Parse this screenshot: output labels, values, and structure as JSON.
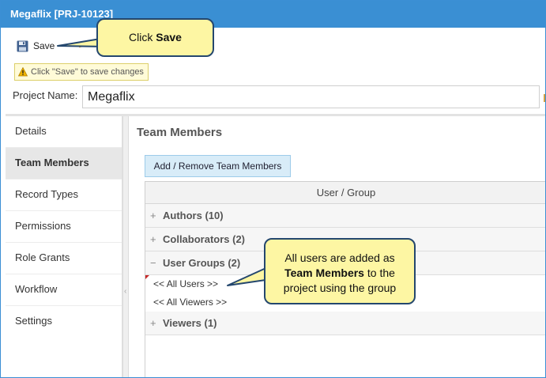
{
  "window": {
    "title": "Megaflix [PRJ-10123]"
  },
  "toolbar": {
    "save_label": "Save"
  },
  "warning": {
    "text": "Click \"Save\" to save changes"
  },
  "project": {
    "name_label": "Project Name:",
    "name_value": "Megaflix"
  },
  "sidebar": {
    "items": [
      {
        "label": "Details"
      },
      {
        "label": "Team Members"
      },
      {
        "label": "Record Types"
      },
      {
        "label": "Permissions"
      },
      {
        "label": "Role Grants"
      },
      {
        "label": "Workflow"
      },
      {
        "label": "Settings"
      }
    ]
  },
  "main": {
    "title": "Team Members",
    "add_button": "Add / Remove Team Members",
    "column_header": "User / Group",
    "groups": [
      {
        "label": "Authors (10)",
        "toggle": "+"
      },
      {
        "label": "Collaborators (2)",
        "toggle": "+"
      },
      {
        "label": "User Groups (2)",
        "toggle": "−"
      },
      {
        "label": "Viewers (1)",
        "toggle": "+"
      }
    ],
    "group_members": [
      "<< All Users >>",
      "<< All Viewers >>"
    ]
  },
  "callouts": {
    "save": {
      "prefix": "Click ",
      "bold": "Save"
    },
    "members": {
      "line1": "All users are added as",
      "bold": "Team Members",
      "after_bold": " to the",
      "line3": "project using the group"
    }
  },
  "colors": {
    "titlebar": "#3a8fd3",
    "callout_fill": "#fdf6a3",
    "callout_border": "#24476e",
    "button_fill": "#d8ecf8"
  }
}
